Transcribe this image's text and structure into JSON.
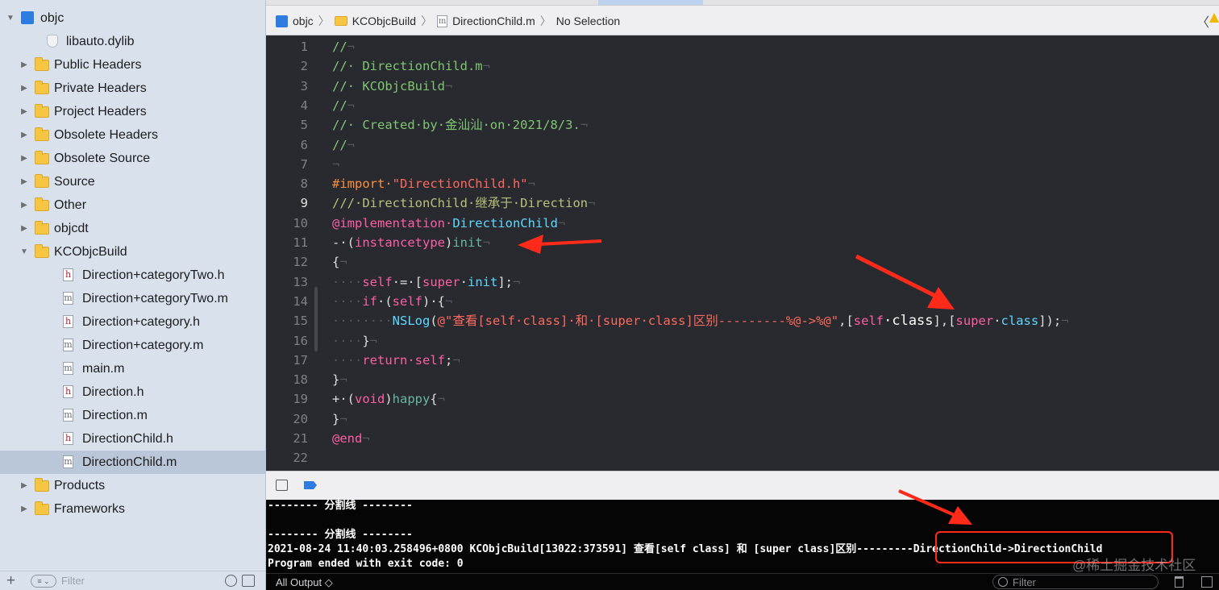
{
  "navigator": {
    "items": [
      {
        "label": "objc",
        "kind": "project",
        "disclosure": "open",
        "selected": false
      },
      {
        "label": "libauto.dylib",
        "kind": "library",
        "disclosure": "none",
        "selected": false
      },
      {
        "label": "Public Headers",
        "kind": "folder",
        "disclosure": "closed",
        "selected": false
      },
      {
        "label": "Private Headers",
        "kind": "folder",
        "disclosure": "closed",
        "selected": false
      },
      {
        "label": "Project Headers",
        "kind": "folder",
        "disclosure": "closed",
        "selected": false
      },
      {
        "label": "Obsolete Headers",
        "kind": "folder",
        "disclosure": "closed",
        "selected": false
      },
      {
        "label": "Obsolete Source",
        "kind": "folder",
        "disclosure": "closed",
        "selected": false
      },
      {
        "label": "Source",
        "kind": "folder",
        "disclosure": "closed",
        "selected": false
      },
      {
        "label": "Other",
        "kind": "folder",
        "disclosure": "closed",
        "selected": false
      },
      {
        "label": "objcdt",
        "kind": "folder",
        "disclosure": "closed",
        "selected": false
      },
      {
        "label": "KCObjcBuild",
        "kind": "folder",
        "disclosure": "open",
        "selected": false
      },
      {
        "label": "Direction+categoryTwo.h",
        "kind": "h",
        "disclosure": "none",
        "selected": false
      },
      {
        "label": "Direction+categoryTwo.m",
        "kind": "m",
        "disclosure": "none",
        "selected": false
      },
      {
        "label": "Direction+category.h",
        "kind": "h",
        "disclosure": "none",
        "selected": false
      },
      {
        "label": "Direction+category.m",
        "kind": "m",
        "disclosure": "none",
        "selected": false
      },
      {
        "label": "main.m",
        "kind": "m",
        "disclosure": "none",
        "selected": false
      },
      {
        "label": "Direction.h",
        "kind": "h",
        "disclosure": "none",
        "selected": false
      },
      {
        "label": "Direction.m",
        "kind": "m",
        "disclosure": "none",
        "selected": false
      },
      {
        "label": "DirectionChild.h",
        "kind": "h",
        "disclosure": "none",
        "selected": false
      },
      {
        "label": "DirectionChild.m",
        "kind": "m",
        "disclosure": "none",
        "selected": true
      },
      {
        "label": "Products",
        "kind": "folder",
        "disclosure": "closed",
        "selected": false
      },
      {
        "label": "Frameworks",
        "kind": "folder",
        "disclosure": "closed",
        "selected": false
      }
    ],
    "filter_placeholder": "Filter",
    "add_label": "+"
  },
  "jumpbar": {
    "project": "objc",
    "group": "KCObjcBuild",
    "file": "DirectionChild.m",
    "symbol": "No Selection"
  },
  "editor": {
    "current_line": 9,
    "lines": [
      {
        "n": "1",
        "tokens": [
          [
            "c-com",
            "//"
          ],
          [
            "c-ws",
            "¬"
          ]
        ]
      },
      {
        "n": "2",
        "tokens": [
          [
            "c-com",
            "//· DirectionChild.m"
          ],
          [
            "c-ws",
            "¬"
          ]
        ]
      },
      {
        "n": "3",
        "tokens": [
          [
            "c-com",
            "//· KCObjcBuild"
          ],
          [
            "c-ws",
            "¬"
          ]
        ]
      },
      {
        "n": "4",
        "tokens": [
          [
            "c-com",
            "//"
          ],
          [
            "c-ws",
            "¬"
          ]
        ]
      },
      {
        "n": "5",
        "tokens": [
          [
            "c-com",
            "//· Created·by·金汕汕·on·2021/8/3."
          ],
          [
            "c-ws",
            "¬"
          ]
        ]
      },
      {
        "n": "6",
        "tokens": [
          [
            "c-com",
            "//"
          ],
          [
            "c-ws",
            "¬"
          ]
        ]
      },
      {
        "n": "7",
        "tokens": [
          [
            "c-ws",
            "¬"
          ]
        ]
      },
      {
        "n": "8",
        "tokens": [
          [
            "c-pre",
            "#import·"
          ],
          [
            "c-str",
            "\"DirectionChild.h\""
          ],
          [
            "c-ws",
            "¬"
          ]
        ]
      },
      {
        "n": "9",
        "tokens": [
          [
            "c-doc",
            "///·DirectionChild·继承于·Direction"
          ],
          [
            "c-ws",
            "¬"
          ]
        ]
      },
      {
        "n": "10",
        "tokens": [
          [
            "c-kw",
            "@implementation·"
          ],
          [
            "c-cls",
            "DirectionChild"
          ],
          [
            "c-ws",
            "¬"
          ]
        ]
      },
      {
        "n": "11",
        "tokens": [
          [
            "c-txt",
            "-·("
          ],
          [
            "c-kw",
            "instancetype"
          ],
          [
            "c-txt",
            ")"
          ],
          [
            "c-fn",
            "init"
          ],
          [
            "c-ws",
            "¬"
          ]
        ]
      },
      {
        "n": "12",
        "tokens": [
          [
            "c-txt",
            "{"
          ],
          [
            "c-ws",
            "¬"
          ]
        ]
      },
      {
        "n": "13",
        "tokens": [
          [
            "c-ws",
            "····"
          ],
          [
            "c-kw",
            "self"
          ],
          [
            "c-txt",
            "·=·["
          ],
          [
            "c-kw",
            "super"
          ],
          [
            "c-txt",
            "·"
          ],
          [
            "c-cls",
            "init"
          ],
          [
            "c-txt",
            "];"
          ],
          [
            "c-ws",
            "¬"
          ]
        ]
      },
      {
        "n": "14",
        "tokens": [
          [
            "c-ws",
            "····"
          ],
          [
            "c-kw",
            "if"
          ],
          [
            "c-txt",
            "·("
          ],
          [
            "c-kw",
            "self"
          ],
          [
            "c-txt",
            ")·{"
          ],
          [
            "c-ws",
            "¬"
          ]
        ]
      },
      {
        "n": "15",
        "tokens": [
          [
            "c-ws",
            "········"
          ],
          [
            "c-cls",
            "NSLog"
          ],
          [
            "c-txt",
            "("
          ],
          [
            "c-str",
            "@\"查看[self·class]·和·[super·class]区别---------%@->%@\""
          ],
          [
            "c-txt",
            ",["
          ],
          [
            "c-kw",
            "self"
          ],
          [
            "c-big",
            "·class"
          ],
          [
            "c-txt",
            "],["
          ],
          [
            "c-kw",
            "super"
          ],
          [
            "c-txt",
            "·"
          ],
          [
            "c-cls",
            "class"
          ],
          [
            "c-txt",
            "]);"
          ],
          [
            "c-ws",
            "¬"
          ]
        ]
      },
      {
        "n": "16",
        "tokens": [
          [
            "c-ws",
            "····"
          ],
          [
            "c-txt",
            "}"
          ],
          [
            "c-ws",
            "¬"
          ]
        ]
      },
      {
        "n": "17",
        "tokens": [
          [
            "c-ws",
            "····"
          ],
          [
            "c-kw",
            "return·self"
          ],
          [
            "c-txt",
            ";"
          ],
          [
            "c-ws",
            "¬"
          ]
        ]
      },
      {
        "n": "18",
        "tokens": [
          [
            "c-txt",
            "}"
          ],
          [
            "c-ws",
            "¬"
          ]
        ]
      },
      {
        "n": "19",
        "tokens": [
          [
            "c-txt",
            "+·("
          ],
          [
            "c-kw",
            "void"
          ],
          [
            "c-txt",
            ")"
          ],
          [
            "c-fn",
            "happy"
          ],
          [
            "c-txt",
            "{"
          ],
          [
            "c-ws",
            "¬"
          ]
        ]
      },
      {
        "n": "20",
        "tokens": [
          [
            "c-txt",
            "}"
          ],
          [
            "c-ws",
            "¬"
          ]
        ]
      },
      {
        "n": "21",
        "tokens": [
          [
            "c-kw",
            "@end"
          ],
          [
            "c-ws",
            "¬"
          ]
        ]
      },
      {
        "n": "22",
        "tokens": []
      }
    ]
  },
  "console": {
    "lines": [
      "-------- 分割线 --------",
      "",
      "-------- 分割线 --------",
      "2021-08-24 11:40:03.258496+0800 KCObjcBuild[13022:373591] 查看[self class] 和 [super class]区别---------DirectionChild->DirectionChild",
      "Program ended with exit code: 0"
    ],
    "output_selector": "All Output ◇",
    "filter_placeholder": "Filter"
  },
  "watermark": "@稀土掘金技术社区",
  "colors": {
    "annotation_red": "#ff2a1a",
    "editor_bg": "#292a30",
    "sidebar_bg": "#d9e2ec",
    "selection": "#b9c7d8"
  }
}
